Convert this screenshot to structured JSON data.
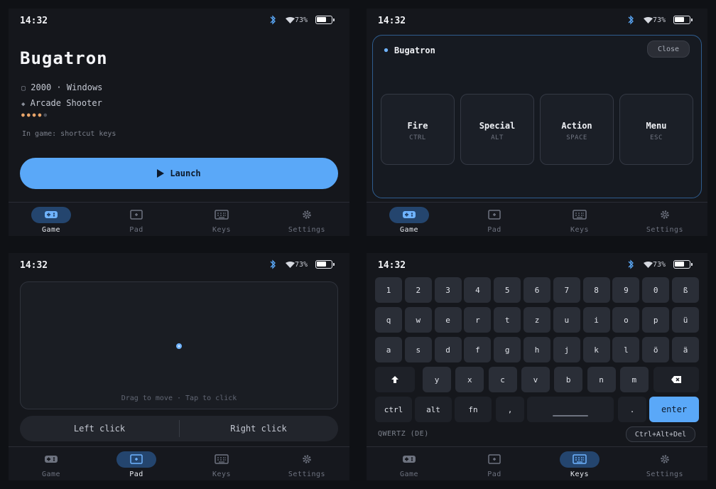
{
  "status": {
    "time": "14:32",
    "battery": "73%"
  },
  "nav": {
    "game": "Game",
    "pad": "Pad",
    "keys": "Keys",
    "settings": "Settings"
  },
  "game_screen": {
    "title": "Bugatron",
    "year_platform": "2000 · Windows",
    "genre": "Arcade Shooter",
    "rating": 4,
    "rating_max": 5,
    "in_game": "In game: shortcut keys",
    "launch_label": "Launch"
  },
  "shortcut_panel": {
    "title": "Bugatron",
    "close_label": "Close",
    "keys": [
      {
        "label": "Fire",
        "key": "CTRL"
      },
      {
        "label": "Special",
        "key": "ALT"
      },
      {
        "label": "Action",
        "key": "SPACE"
      },
      {
        "label": "Menu",
        "key": "ESC"
      }
    ]
  },
  "pad_screen": {
    "hint": "Drag to move · Tap to click",
    "left_click": "Left click",
    "right_click": "Right click"
  },
  "keyboard": {
    "row1": [
      "1",
      "2",
      "3",
      "4",
      "5",
      "6",
      "7",
      "8",
      "9",
      "0",
      "ß"
    ],
    "row2": [
      "q",
      "w",
      "e",
      "r",
      "t",
      "z",
      "u",
      "i",
      "o",
      "p",
      "ü"
    ],
    "row3": [
      "a",
      "s",
      "d",
      "f",
      "g",
      "h",
      "j",
      "k",
      "l",
      "ö",
      "ä"
    ],
    "row4": [
      "y",
      "x",
      "c",
      "v",
      "b",
      "n",
      "m"
    ],
    "ctrl": "ctrl",
    "alt": "alt",
    "fn": "fn",
    "comma": ",",
    "period": ".",
    "enter": "enter",
    "layout": "QWERTZ (DE)",
    "cad": "Ctrl+Alt+Del"
  },
  "colors": {
    "accent": "#5aa8f8",
    "active_nav": "#24456e",
    "star": "#e9a56a"
  }
}
